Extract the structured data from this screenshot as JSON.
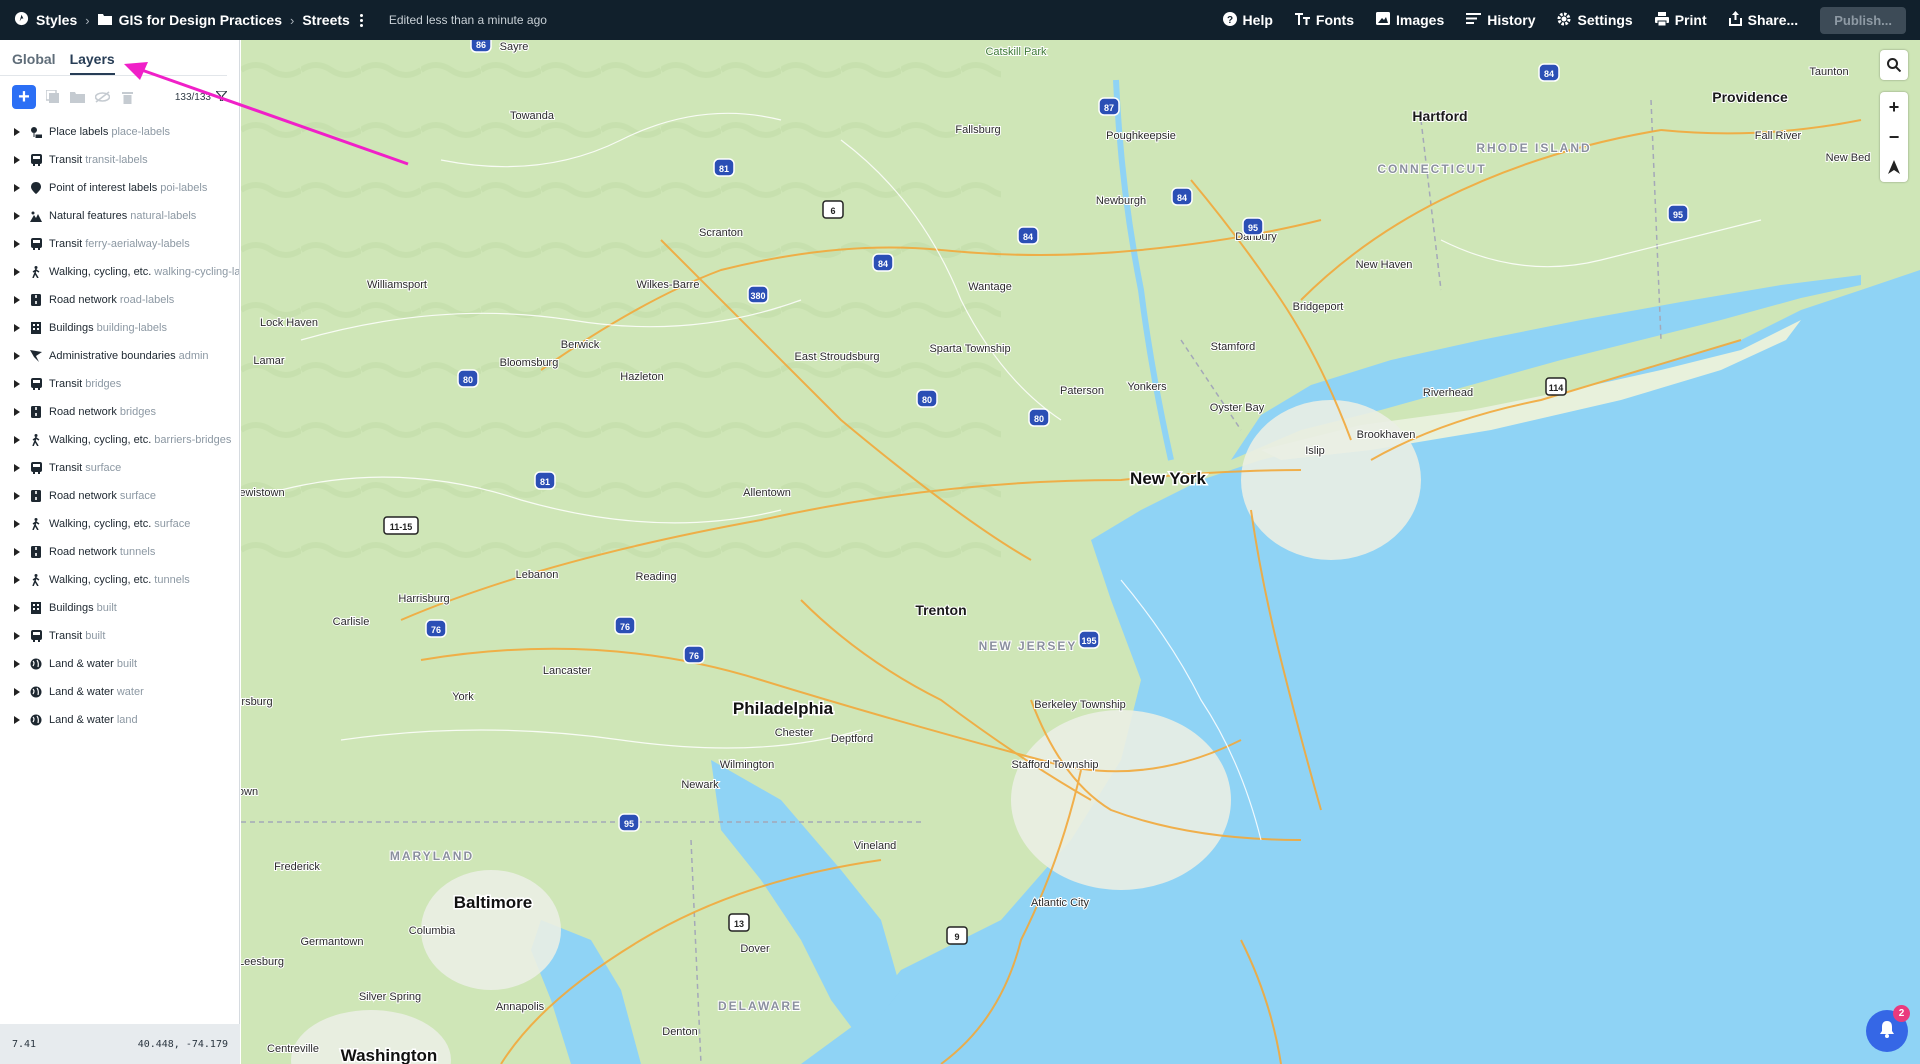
{
  "topbar": {
    "styles_label": "Styles",
    "project_label": "GIS for Design Practices",
    "style_name": "Streets",
    "edited_status": "Edited less than a minute ago",
    "help_label": "Help",
    "fonts_label": "Fonts",
    "images_label": "Images",
    "history_label": "History",
    "settings_label": "Settings",
    "print_label": "Print",
    "share_label": "Share...",
    "publish_label": "Publish..."
  },
  "sidebar": {
    "tabs": [
      {
        "label": "Global"
      },
      {
        "label": "Layers"
      }
    ],
    "layer_count": "133/133",
    "layers": [
      {
        "name": "Place labels",
        "sub": "place-labels",
        "icon": "place-labels-icon"
      },
      {
        "name": "Transit",
        "sub": "transit-labels",
        "icon": "transit-icon"
      },
      {
        "name": "Point of interest labels",
        "sub": "poi-labels",
        "icon": "poi-pin-icon"
      },
      {
        "name": "Natural features",
        "sub": "natural-labels",
        "icon": "natural-features-icon"
      },
      {
        "name": "Transit",
        "sub": "ferry-aerialway-labels",
        "icon": "transit-icon"
      },
      {
        "name": "Walking, cycling, etc.",
        "sub": "walking-cycling-lal",
        "icon": "walking-icon"
      },
      {
        "name": "Road network",
        "sub": "road-labels",
        "icon": "road-icon"
      },
      {
        "name": "Buildings",
        "sub": "building-labels",
        "icon": "building-icon"
      },
      {
        "name": "Administrative boundaries",
        "sub": "admin",
        "icon": "admin-flag-icon"
      },
      {
        "name": "Transit",
        "sub": "bridges",
        "icon": "transit-icon"
      },
      {
        "name": "Road network",
        "sub": "bridges",
        "icon": "road-icon"
      },
      {
        "name": "Walking, cycling, etc.",
        "sub": "barriers-bridges",
        "icon": "walking-icon"
      },
      {
        "name": "Transit",
        "sub": "surface",
        "icon": "transit-icon"
      },
      {
        "name": "Road network",
        "sub": "surface",
        "icon": "road-icon"
      },
      {
        "name": "Walking, cycling, etc.",
        "sub": "surface",
        "icon": "walking-icon"
      },
      {
        "name": "Road network",
        "sub": "tunnels",
        "icon": "road-icon"
      },
      {
        "name": "Walking, cycling, etc.",
        "sub": "tunnels",
        "icon": "walking-icon"
      },
      {
        "name": "Buildings",
        "sub": "built",
        "icon": "building-icon"
      },
      {
        "name": "Transit",
        "sub": "built",
        "icon": "transit-icon"
      },
      {
        "name": "Land & water",
        "sub": "built",
        "icon": "globe-icon"
      },
      {
        "name": "Land & water",
        "sub": "water",
        "icon": "globe-icon"
      },
      {
        "name": "Land & water",
        "sub": "land",
        "icon": "globe-icon"
      }
    ],
    "zoom": "7.41",
    "coords": "40.448, -74.179"
  },
  "map": {
    "labels": [
      {
        "text": "New York",
        "cls": "big"
      },
      {
        "text": "Philadelphia",
        "cls": "big"
      },
      {
        "text": "Baltimore",
        "cls": "big"
      },
      {
        "text": "Washington",
        "cls": "big"
      },
      {
        "text": "Trenton",
        "cls": "mid"
      },
      {
        "text": "Hartford",
        "cls": "mid"
      },
      {
        "text": "Providence",
        "cls": "mid"
      },
      {
        "text": "Allentown",
        "cls": "sm"
      },
      {
        "text": "Reading",
        "cls": "sm"
      },
      {
        "text": "Harrisburg",
        "cls": "sm"
      },
      {
        "text": "Lancaster",
        "cls": "sm"
      },
      {
        "text": "York",
        "cls": "sm"
      },
      {
        "text": "Scranton",
        "cls": "sm"
      },
      {
        "text": "Wilkes-Barre",
        "cls": "sm"
      },
      {
        "text": "Wilmington",
        "cls": "sm"
      },
      {
        "text": "Atlantic City",
        "cls": "sm"
      },
      {
        "text": "Dover",
        "cls": "sm"
      },
      {
        "text": "Annapolis",
        "cls": "sm"
      },
      {
        "text": "Newark",
        "cls": "sm"
      },
      {
        "text": "Vineland",
        "cls": "sm"
      },
      {
        "text": "Bridgeport",
        "cls": "sm"
      },
      {
        "text": "New Haven",
        "cls": "sm"
      },
      {
        "text": "Stamford",
        "cls": "sm"
      },
      {
        "text": "Paterson",
        "cls": "sm"
      },
      {
        "text": "Yonkers",
        "cls": "sm"
      },
      {
        "text": "Oyster Bay",
        "cls": "sm"
      },
      {
        "text": "Islip",
        "cls": "sm"
      },
      {
        "text": "Brookhaven",
        "cls": "sm"
      },
      {
        "text": "Riverhead",
        "cls": "sm"
      },
      {
        "text": "Danbury",
        "cls": "sm"
      },
      {
        "text": "Newburgh",
        "cls": "sm"
      },
      {
        "text": "Poughkeepsie",
        "cls": "sm"
      },
      {
        "text": "Fallsburg",
        "cls": "sm"
      },
      {
        "text": "Frederick",
        "cls": "sm"
      },
      {
        "text": "Columbia",
        "cls": "sm"
      },
      {
        "text": "Germantown",
        "cls": "sm"
      },
      {
        "text": "Silver Spring",
        "cls": "sm"
      },
      {
        "text": "Centreville",
        "cls": "sm"
      },
      {
        "text": "Carlisle",
        "cls": "sm"
      },
      {
        "text": "Lebanon",
        "cls": "sm"
      },
      {
        "text": "Chester",
        "cls": "sm"
      },
      {
        "text": "Deptford",
        "cls": "sm"
      },
      {
        "text": "Bloomsburg",
        "cls": "sm"
      },
      {
        "text": "Hazleton",
        "cls": "sm"
      },
      {
        "text": "Berwick",
        "cls": "sm"
      },
      {
        "text": "Williamsport",
        "cls": "sm"
      },
      {
        "text": "Lock Haven",
        "cls": "sm"
      },
      {
        "text": "Towanda",
        "cls": "sm"
      },
      {
        "text": "Sayre",
        "cls": "sm"
      },
      {
        "text": "East Stroudsburg",
        "cls": "sm"
      },
      {
        "text": "Sparta Township",
        "cls": "sm"
      },
      {
        "text": "Wantage",
        "cls": "sm"
      },
      {
        "text": "Berkeley Township",
        "cls": "sm"
      },
      {
        "text": "Stafford Township",
        "cls": "sm"
      },
      {
        "text": "Fall River",
        "cls": "sm"
      },
      {
        "text": "New Bed",
        "cls": "sm"
      },
      {
        "text": "Taunton",
        "cls": "sm"
      },
      {
        "text": "Lamar",
        "cls": "sm"
      },
      {
        "text": "ewistown",
        "cls": "sm"
      },
      {
        "text": "rsburg",
        "cls": "sm"
      },
      {
        "text": "own",
        "cls": "sm"
      },
      {
        "text": "Leesburg",
        "cls": "sm"
      },
      {
        "text": "Denton",
        "cls": "sm"
      },
      {
        "text": "Catskill Park",
        "cls": "park"
      },
      {
        "text": "CONNECTICUT",
        "cls": "state"
      },
      {
        "text": "NEW JERSEY",
        "cls": "state"
      },
      {
        "text": "MARYLAND",
        "cls": "state"
      },
      {
        "text": "DELAWARE",
        "cls": "state"
      },
      {
        "text": "RHODE ISLAND",
        "cls": "state"
      }
    ],
    "shields": [
      "86",
      "87",
      "84",
      "84",
      "81",
      "6",
      "84",
      "84",
      "380",
      "95",
      "95",
      "80",
      "80",
      "80",
      "81",
      "11-15",
      "76",
      "76",
      "76",
      "195",
      "95",
      "13",
      "9",
      "114"
    ],
    "notification_count": "2"
  },
  "colors": {
    "topbar_bg": "#11202c",
    "accent": "#2b6ff5",
    "land": "#cfe6b7",
    "water": "#8fd3f5",
    "annotation_arrow": "#f020c8"
  }
}
